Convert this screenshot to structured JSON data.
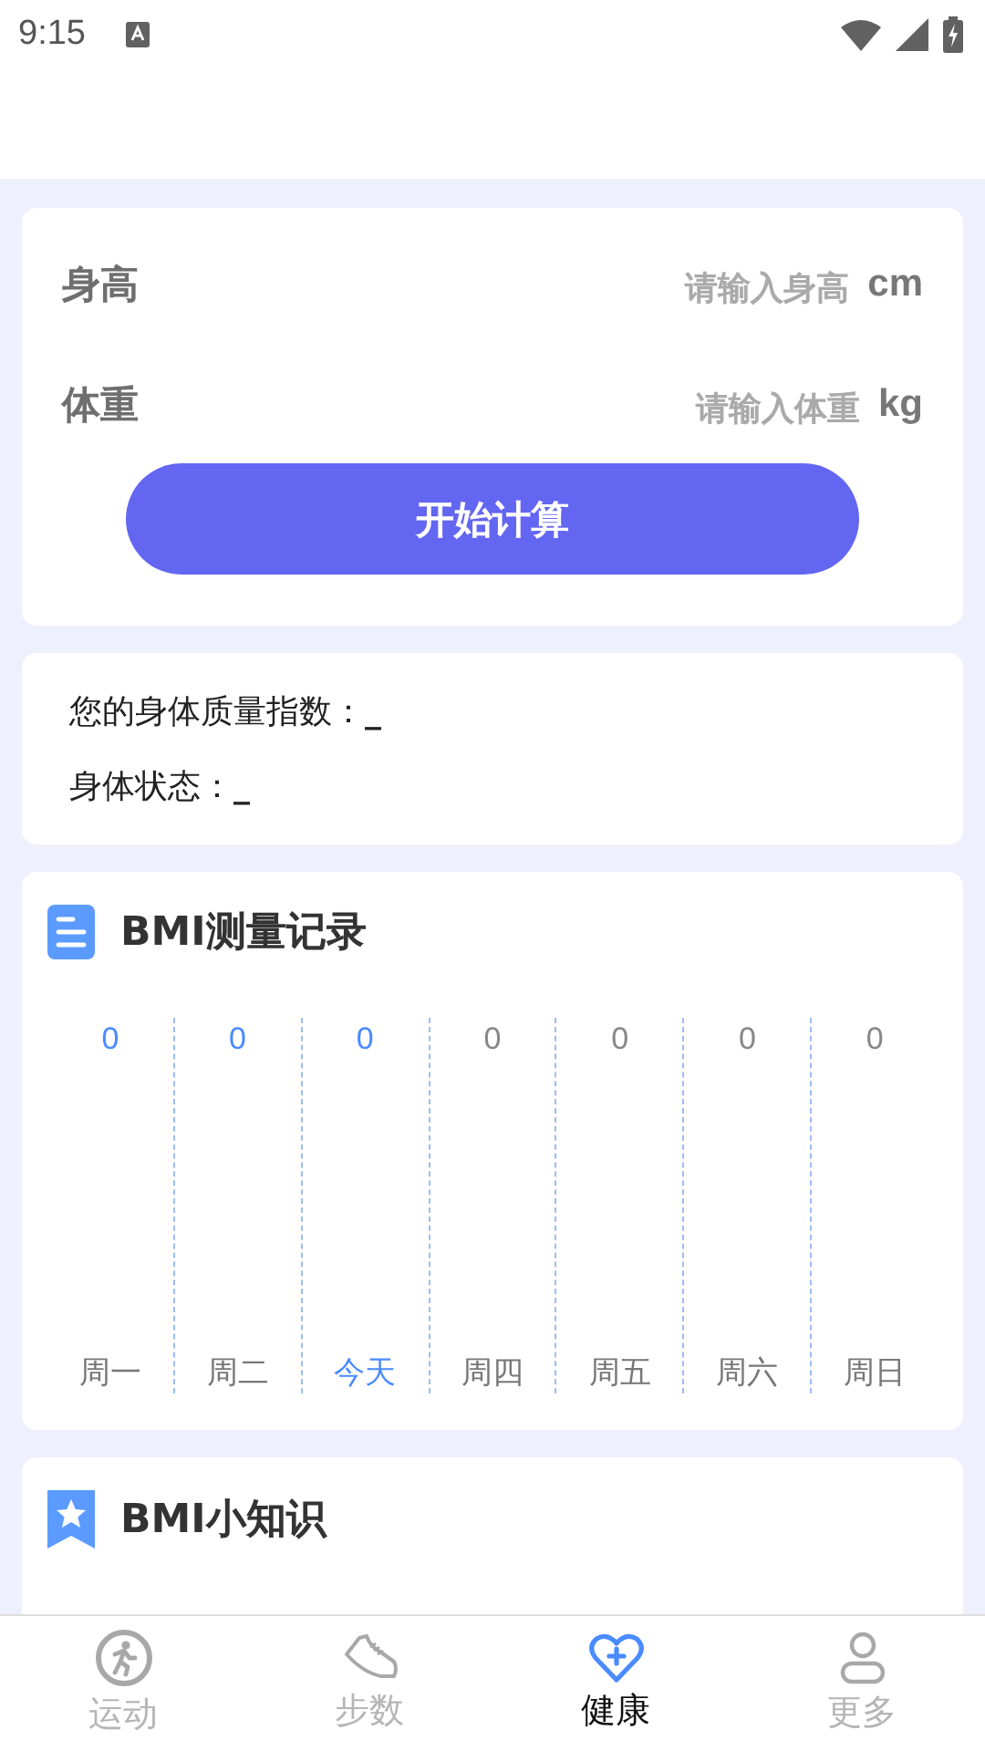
{
  "status_bar": {
    "time": "9:15"
  },
  "form": {
    "fields": [
      {
        "label": "身高",
        "placeholder": "请输入身高",
        "unit": "cm"
      },
      {
        "label": "体重",
        "placeholder": "请输入体重",
        "unit": "kg"
      }
    ],
    "button": "开始计算"
  },
  "result": [
    {
      "label": "您的身体质量指数：",
      "value": "_"
    },
    {
      "label": "身体状态：",
      "value": "_"
    }
  ],
  "record": {
    "title": "BMI测量记录",
    "days": [
      {
        "value": "0",
        "day": "周一",
        "highlighted": true,
        "selected": false
      },
      {
        "value": "0",
        "day": "周二",
        "highlighted": true,
        "selected": false
      },
      {
        "value": "0",
        "day": "今天",
        "highlighted": true,
        "selected": true
      },
      {
        "value": "0",
        "day": "周四",
        "highlighted": false,
        "selected": false
      },
      {
        "value": "0",
        "day": "周五",
        "highlighted": false,
        "selected": false
      },
      {
        "value": "0",
        "day": "周六",
        "highlighted": false,
        "selected": false
      },
      {
        "value": "0",
        "day": "周日",
        "highlighted": false,
        "selected": false
      }
    ]
  },
  "tips": {
    "title": "BMI小知识"
  },
  "tab_bar": [
    {
      "label": "运动",
      "kind": "run",
      "selected": false
    },
    {
      "label": "步数",
      "kind": "shoe",
      "selected": false
    },
    {
      "label": "健康",
      "kind": "heart",
      "selected": true
    },
    {
      "label": "更多",
      "kind": "person",
      "selected": false
    }
  ]
}
